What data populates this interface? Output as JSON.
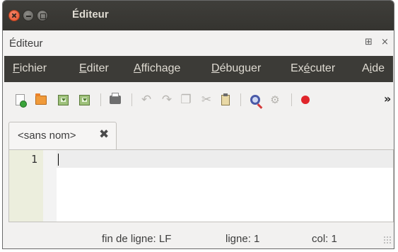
{
  "window": {
    "title": "Éditeur"
  },
  "panel": {
    "title": "Éditeur",
    "detach_icon": "⊞",
    "close_icon": "×"
  },
  "menu": {
    "items": [
      {
        "mnemonic": "F",
        "rest": "ichier"
      },
      {
        "mnemonic": "E",
        "rest": "diter"
      },
      {
        "mnemonic": "A",
        "rest": "ffichage"
      },
      {
        "mnemonic": "D",
        "rest": "ébuguer"
      },
      {
        "pre": "Ex",
        "mnemonic": "é",
        "rest": "cuter"
      },
      {
        "pre": "A",
        "mnemonic": "i",
        "rest": "de"
      }
    ]
  },
  "toolbar": {
    "icons": [
      "new-file-icon",
      "open-folder-icon",
      "save-icon",
      "save-as-icon",
      "print-icon",
      "undo-icon",
      "redo-icon",
      "copy-icon",
      "cut-icon",
      "paste-icon",
      "find-icon",
      "run-settings-icon",
      "record-icon"
    ],
    "glyphs": {
      "undo": "↶",
      "redo": "↷",
      "copy": "❐",
      "cut": "✂",
      "gears": "⚙",
      "more": "»"
    },
    "record_color": "#e0252b"
  },
  "tabs": [
    {
      "label": "<sans nom>",
      "close_glyph": "✖"
    }
  ],
  "editor": {
    "line_numbers": [
      "1"
    ],
    "content": ""
  },
  "status": {
    "line_ending": "fin de ligne: LF",
    "line": "ligne: 1",
    "col": "col: 1"
  },
  "colors": {
    "titlebar": "#3c3b37",
    "menubar": "#3c3b37",
    "close_button": "#e2512a",
    "gutter": "#eceedd"
  }
}
